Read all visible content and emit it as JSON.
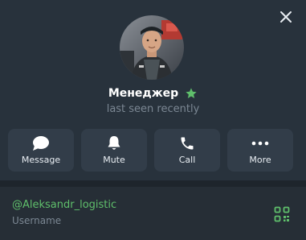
{
  "profile": {
    "name": "Менеджер",
    "status": "last seen recently",
    "username": "@Aleksandr_logistic",
    "username_caption": "Username"
  },
  "actions": [
    {
      "label": "Message",
      "icon": "message-icon"
    },
    {
      "label": "Mute",
      "icon": "bell-icon"
    },
    {
      "label": "Call",
      "icon": "phone-icon"
    },
    {
      "label": "More",
      "icon": "more-icon"
    }
  ],
  "colors": {
    "background": "#262e36",
    "button": "#323d49",
    "accent_green": "#5fbf6b",
    "muted_text": "#7b8793"
  }
}
